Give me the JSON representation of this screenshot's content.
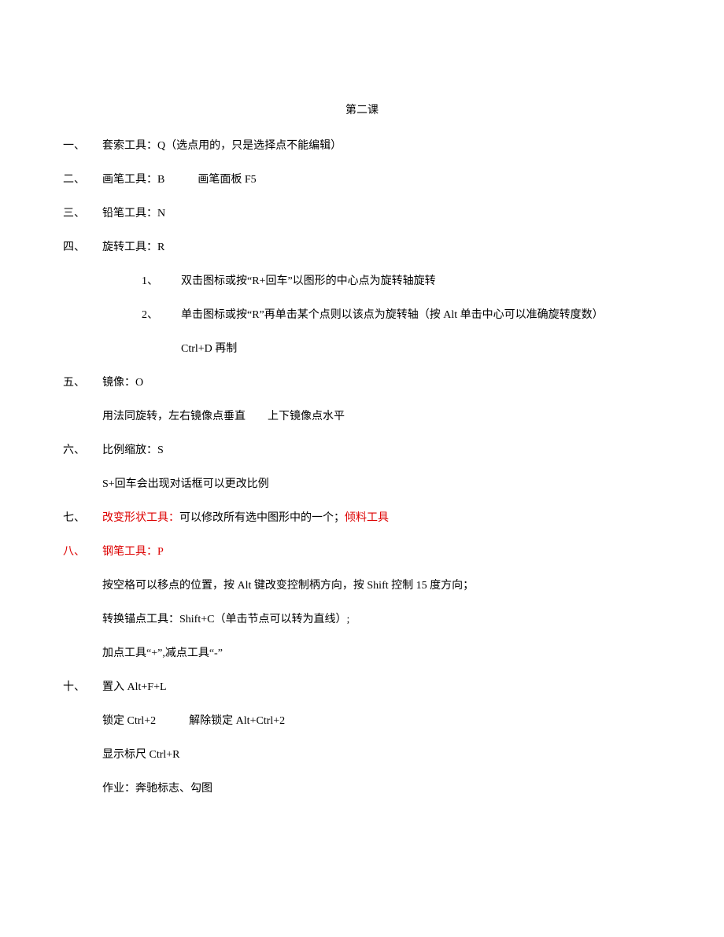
{
  "title": "第二课",
  "items": [
    {
      "num": "一、",
      "main": "套索工具：Q（选点用的，只是选择点不能编辑）",
      "mainRed": false,
      "subs": [],
      "lines": []
    },
    {
      "num": "二、",
      "main": "画笔工具：B　　　画笔面板 F5",
      "mainRed": false,
      "subs": [],
      "lines": []
    },
    {
      "num": "三、",
      "main": "铅笔工具：N",
      "mainRed": false,
      "subs": [],
      "lines": []
    },
    {
      "num": "四、",
      "main": "旋转工具：R",
      "mainRed": false,
      "subs": [
        {
          "num": "1、",
          "text": "双击图标或按“R+回车”以图形的中心点为旋转轴旋转"
        },
        {
          "num": "2、",
          "text": "单击图标或按“R”再单击某个点则以该点为旋转轴（按 Alt 单击中心可以准确旋转度数）"
        }
      ],
      "subExtra": "Ctrl+D 再制",
      "lines": []
    },
    {
      "num": "五、",
      "main": "镜像：O",
      "mainRed": false,
      "subs": [],
      "lines": [
        "用法同旋转，左右镜像点垂直　　上下镜像点水平"
      ]
    },
    {
      "num": "六、",
      "main": "比例缩放：S",
      "mainRed": false,
      "subs": [],
      "lines": [
        "S+回车会出现对话框可以更改比例"
      ]
    },
    {
      "num": "七、",
      "main": "",
      "mainRed": false,
      "mixed": [
        {
          "text": "改变形状工具：",
          "red": true
        },
        {
          "text": "可以修改所有选中图形中的一个；",
          "red": false
        },
        {
          "text": "倾料工具",
          "red": true
        }
      ],
      "subs": [],
      "lines": []
    },
    {
      "num": "八、",
      "numRed": true,
      "main": "钢笔工具：P",
      "mainRed": true,
      "subs": [],
      "lines": [
        "按空格可以移点的位置，按 Alt 键改变控制柄方向，按 Shift 控制 15 度方向；",
        "转换锚点工具：Shift+C（单击节点可以转为直线）;",
        "加点工具“+”,减点工具“-”"
      ]
    },
    {
      "num": "十、",
      "main": "置入 Alt+F+L",
      "mainRed": false,
      "subs": [],
      "lines": [
        "锁定 Ctrl+2　　　解除锁定  Alt+Ctrl+2",
        "显示标尺 Ctrl+R",
        "作业：奔驰标志、勾图"
      ]
    }
  ]
}
